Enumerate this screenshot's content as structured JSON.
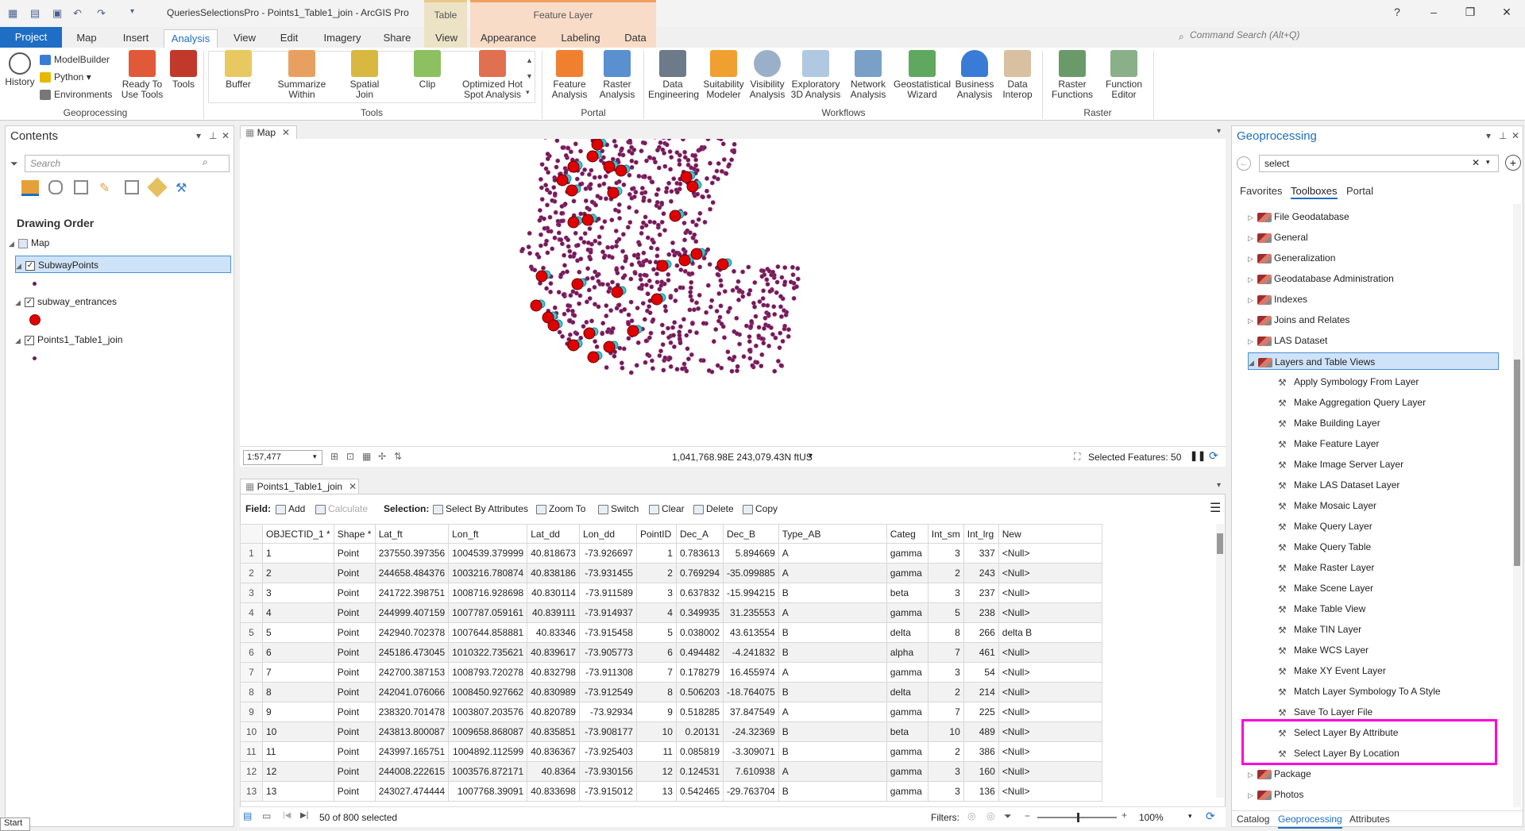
{
  "app": {
    "title": "QueriesSelectionsPro - Points1_Table1_join - ArcGIS Pro"
  },
  "context_tabs": {
    "table_group": "Table",
    "feature_group": "Feature Layer"
  },
  "window": {
    "help": "?"
  },
  "ribbon_tabs": [
    "Project",
    "Map",
    "Insert",
    "Analysis",
    "View",
    "Edit",
    "Imagery",
    "Share",
    "View",
    "Appearance",
    "Labeling",
    "Data"
  ],
  "command_search": {
    "placeholder": "Command Search (Alt+Q)"
  },
  "ribbon": {
    "geoprocessing": {
      "label": "Geoprocessing",
      "history": "History",
      "modelbuilder": "ModelBuilder",
      "python": "Python",
      "environments": "Environments",
      "ready_l1": "Ready To",
      "ready_l2": "Use Tools",
      "tools": "Tools"
    },
    "tools": {
      "label": "Tools",
      "items": [
        [
          "Buffer",
          ""
        ],
        [
          "Summarize",
          "Within"
        ],
        [
          "Spatial",
          "Join"
        ],
        [
          "Clip",
          ""
        ],
        [
          "Optimized Hot",
          "Spot Analysis"
        ]
      ]
    },
    "portal": {
      "label": "Portal",
      "items": [
        [
          "Feature",
          "Analysis"
        ],
        [
          "Raster",
          "Analysis"
        ]
      ]
    },
    "workflows": {
      "label": "Workflows",
      "items": [
        [
          "Data",
          "Engineering"
        ],
        [
          "Suitability",
          "Modeler"
        ],
        [
          "Visibility",
          "Analysis"
        ],
        [
          "Exploratory",
          "3D Analysis"
        ],
        [
          "Network",
          "Analysis"
        ],
        [
          "Geostatistical",
          "Wizard"
        ],
        [
          "Business",
          "Analysis"
        ],
        [
          "Data",
          "Interop"
        ]
      ]
    },
    "raster": {
      "label": "Raster",
      "items": [
        [
          "Raster",
          "Functions"
        ],
        [
          "Function",
          "Editor"
        ]
      ]
    }
  },
  "contents": {
    "title": "Contents",
    "search_placeholder": "Search",
    "drawing_order": "Drawing Order",
    "map": "Map",
    "layers": [
      "SubwayPoints",
      "subway_entrances",
      "Points1_Table1_join"
    ]
  },
  "map_view": {
    "tab": "Map",
    "scale": "1:57,477",
    "coords": "1,041,768.98E 243,079.43N ftUS",
    "selected_features": "Selected Features: 50"
  },
  "table_view": {
    "tab": "Points1_Table1_join",
    "field_label": "Field:",
    "add": "Add",
    "calculate": "Calculate",
    "selection_label": "Selection:",
    "select_by_attributes": "Select By Attributes",
    "zoom_to": "Zoom To",
    "switch": "Switch",
    "clear": "Clear",
    "delete": "Delete",
    "copy": "Copy",
    "columns": [
      "OBJECTID_1 *",
      "Shape *",
      "Lat_ft",
      "Lon_ft",
      "Lat_dd",
      "Lon_dd",
      "PointID",
      "Dec_A",
      "Dec_B",
      "Type_AB",
      "Categ",
      "Int_sm",
      "Int_lrg",
      "New"
    ],
    "rows": [
      [
        "1",
        "1",
        "Point",
        "237550.397356",
        "1004539.379999",
        "40.818673",
        "-73.926697",
        "1",
        "0.783613",
        "5.894669",
        "A",
        "gamma",
        "3",
        "337",
        "<Null>"
      ],
      [
        "2",
        "2",
        "Point",
        "244658.484376",
        "1003216.780874",
        "40.838186",
        "-73.931455",
        "2",
        "0.769294",
        "-35.099885",
        "A",
        "gamma",
        "2",
        "243",
        "<Null>"
      ],
      [
        "3",
        "3",
        "Point",
        "241722.398751",
        "1008716.928698",
        "40.830114",
        "-73.911589",
        "3",
        "0.637832",
        "-15.994215",
        "B",
        "beta",
        "3",
        "237",
        "<Null>"
      ],
      [
        "4",
        "4",
        "Point",
        "244999.407159",
        "1007787.059161",
        "40.839111",
        "-73.914937",
        "4",
        "0.349935",
        "31.235553",
        "A",
        "gamma",
        "5",
        "238",
        "<Null>"
      ],
      [
        "5",
        "5",
        "Point",
        "242940.702378",
        "1007644.858881",
        "40.83346",
        "-73.915458",
        "5",
        "0.038002",
        "43.613554",
        "B",
        "delta",
        "8",
        "266",
        "delta B"
      ],
      [
        "6",
        "6",
        "Point",
        "245186.473045",
        "1010322.735621",
        "40.839617",
        "-73.905773",
        "6",
        "0.494482",
        "-4.241832",
        "B",
        "alpha",
        "7",
        "461",
        "<Null>"
      ],
      [
        "7",
        "7",
        "Point",
        "242700.387153",
        "1008793.720278",
        "40.832798",
        "-73.911308",
        "7",
        "0.178279",
        "16.455974",
        "A",
        "gamma",
        "3",
        "54",
        "<Null>"
      ],
      [
        "8",
        "8",
        "Point",
        "242041.076066",
        "1008450.927662",
        "40.830989",
        "-73.912549",
        "8",
        "0.506203",
        "-18.764075",
        "B",
        "delta",
        "2",
        "214",
        "<Null>"
      ],
      [
        "9",
        "9",
        "Point",
        "238320.701478",
        "1003807.203576",
        "40.820789",
        "-73.92934",
        "9",
        "0.518285",
        "37.847549",
        "A",
        "gamma",
        "7",
        "225",
        "<Null>"
      ],
      [
        "10",
        "10",
        "Point",
        "243813.800087",
        "1009658.868087",
        "40.835851",
        "-73.908177",
        "10",
        "0.20131",
        "-24.32369",
        "B",
        "beta",
        "10",
        "489",
        "<Null>"
      ],
      [
        "11",
        "11",
        "Point",
        "243997.165751",
        "1004892.112599",
        "40.836367",
        "-73.925403",
        "11",
        "0.085819",
        "-3.309071",
        "B",
        "gamma",
        "2",
        "386",
        "<Null>"
      ],
      [
        "12",
        "12",
        "Point",
        "244008.222615",
        "1003576.872171",
        "40.8364",
        "-73.930156",
        "12",
        "0.124531",
        "7.610938",
        "A",
        "gamma",
        "3",
        "160",
        "<Null>"
      ],
      [
        "13",
        "13",
        "Point",
        "243027.474444",
        "1007768.39091",
        "40.833698",
        "-73.915012",
        "13",
        "0.542465",
        "-29.763704",
        "B",
        "gamma",
        "3",
        "136",
        "<Null>"
      ]
    ],
    "selected_count": "50 of 800 selected",
    "filters": "Filters:",
    "zoom": "100%"
  },
  "geoprocessing": {
    "title": "Geoprocessing",
    "search_value": "select",
    "tabs": [
      "Favorites",
      "Toolboxes",
      "Portal"
    ],
    "toolboxes": [
      "File Geodatabase",
      "General",
      "Generalization",
      "Geodatabase Administration",
      "Indexes",
      "Joins and Relates",
      "LAS Dataset",
      "Layers and Table Views"
    ],
    "tools": [
      "Apply Symbology From Layer",
      "Make Aggregation Query Layer",
      "Make Building Layer",
      "Make Feature Layer",
      "Make Image Server Layer",
      "Make LAS Dataset Layer",
      "Make Mosaic Layer",
      "Make Query Layer",
      "Make Query Table",
      "Make Raster Layer",
      "Make Scene Layer",
      "Make Table View",
      "Make TIN Layer",
      "Make WCS Layer",
      "Make XY Event Layer",
      "Match Layer Symbology To A Style",
      "Save To Layer File",
      "Select Layer By Attribute",
      "Select Layer By Location"
    ],
    "toolboxes_after": [
      "Package",
      "Photos"
    ],
    "bottom_tabs": [
      "Catalog",
      "Geoprocessing",
      "Attributes"
    ]
  },
  "status": {
    "start": "Start"
  },
  "colors": {
    "accent": "#1d6ec4",
    "highlight": "#ff00dc",
    "selected_row": "#cfe3f8",
    "point": "#6b1e52",
    "entrance": "#e00000",
    "selection": "#3ec8d8"
  }
}
